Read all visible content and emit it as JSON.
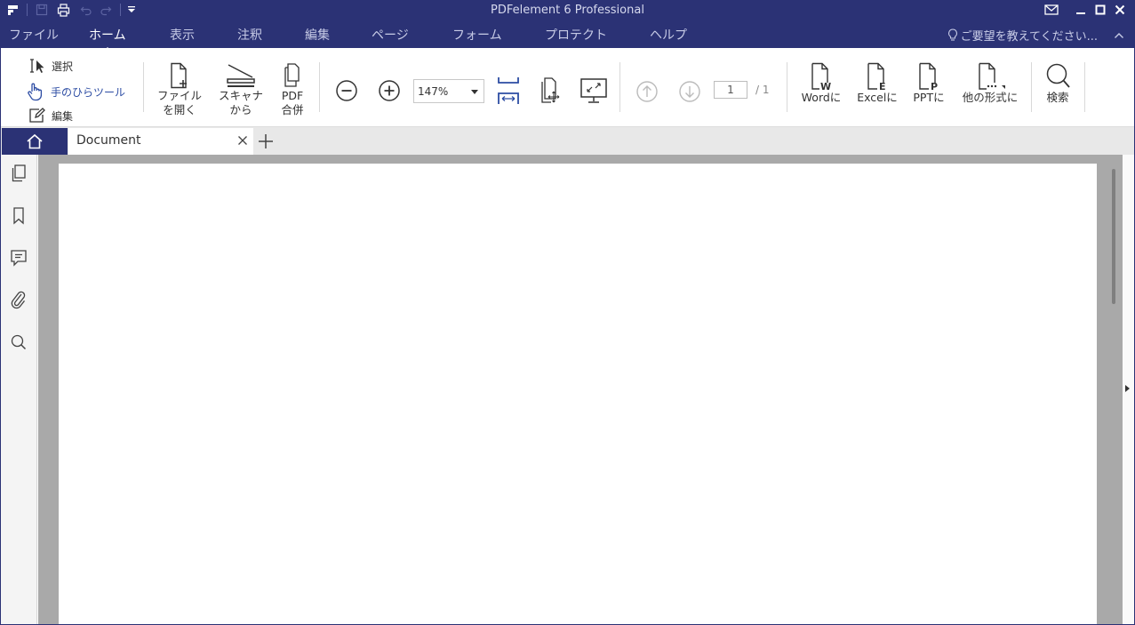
{
  "window": {
    "title": "PDFelement 6 Professional"
  },
  "quick_access": [
    "app-icon",
    "save-icon",
    "print-icon",
    "undo-icon",
    "redo-icon",
    "customize-icon"
  ],
  "menu": {
    "items": [
      "ファイル",
      "ホーム",
      "表示",
      "注釈",
      "編集",
      "ページ",
      "フォーム",
      "プロテクト",
      "ヘルプ"
    ],
    "active": "ホーム",
    "help_text": "ご要望を教えてください..."
  },
  "ribbon": {
    "tools": {
      "select": "選択",
      "hand": "手のひらツール",
      "edit": "編集"
    },
    "open_file": "ファイル\nを開く",
    "from_scanner": "スキャナ\nから",
    "merge_pdf": "PDF\n合併",
    "zoom_value": "147%",
    "page_current": "1",
    "page_total": "/ 1",
    "to_word": "Wordに",
    "to_excel": "Excelに",
    "to_ppt": "PPTに",
    "to_other": "他の形式に",
    "search": "検索"
  },
  "tabs": {
    "document": "Document"
  },
  "colors": {
    "accent": "#2b3275",
    "active_tool": "#2c4ca3",
    "canvas": "#a9a9a9"
  }
}
